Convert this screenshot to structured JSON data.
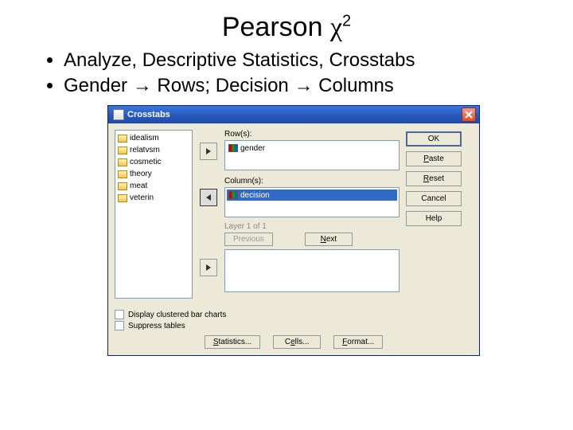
{
  "slide": {
    "title_main": "Pearson ",
    "title_sym": "χ",
    "title_sup": "2",
    "bullets": [
      "Analyze, Descriptive Statistics, Crosstabs",
      "Gender → Rows; Decision → Columns"
    ]
  },
  "dialog": {
    "title": "Crosstabs",
    "vars": [
      "idealism",
      "relatvsm",
      "cosmetic",
      "theory",
      "meat",
      "veterin"
    ],
    "rows_label": "Row(s):",
    "rows_items": [
      "gender"
    ],
    "cols_label": "Column(s):",
    "cols_items": [
      "decision"
    ],
    "layer_label": "Layer 1 of 1",
    "prev": "Previous",
    "next": "Next",
    "check1": "Display clustered bar charts",
    "check2": "Suppress tables",
    "buttons": {
      "ok": "OK",
      "paste": "Paste",
      "reset": "Reset",
      "cancel": "Cancel",
      "help": "Help",
      "stats": "Statistics...",
      "cells": "Cells...",
      "format": "Format..."
    }
  }
}
